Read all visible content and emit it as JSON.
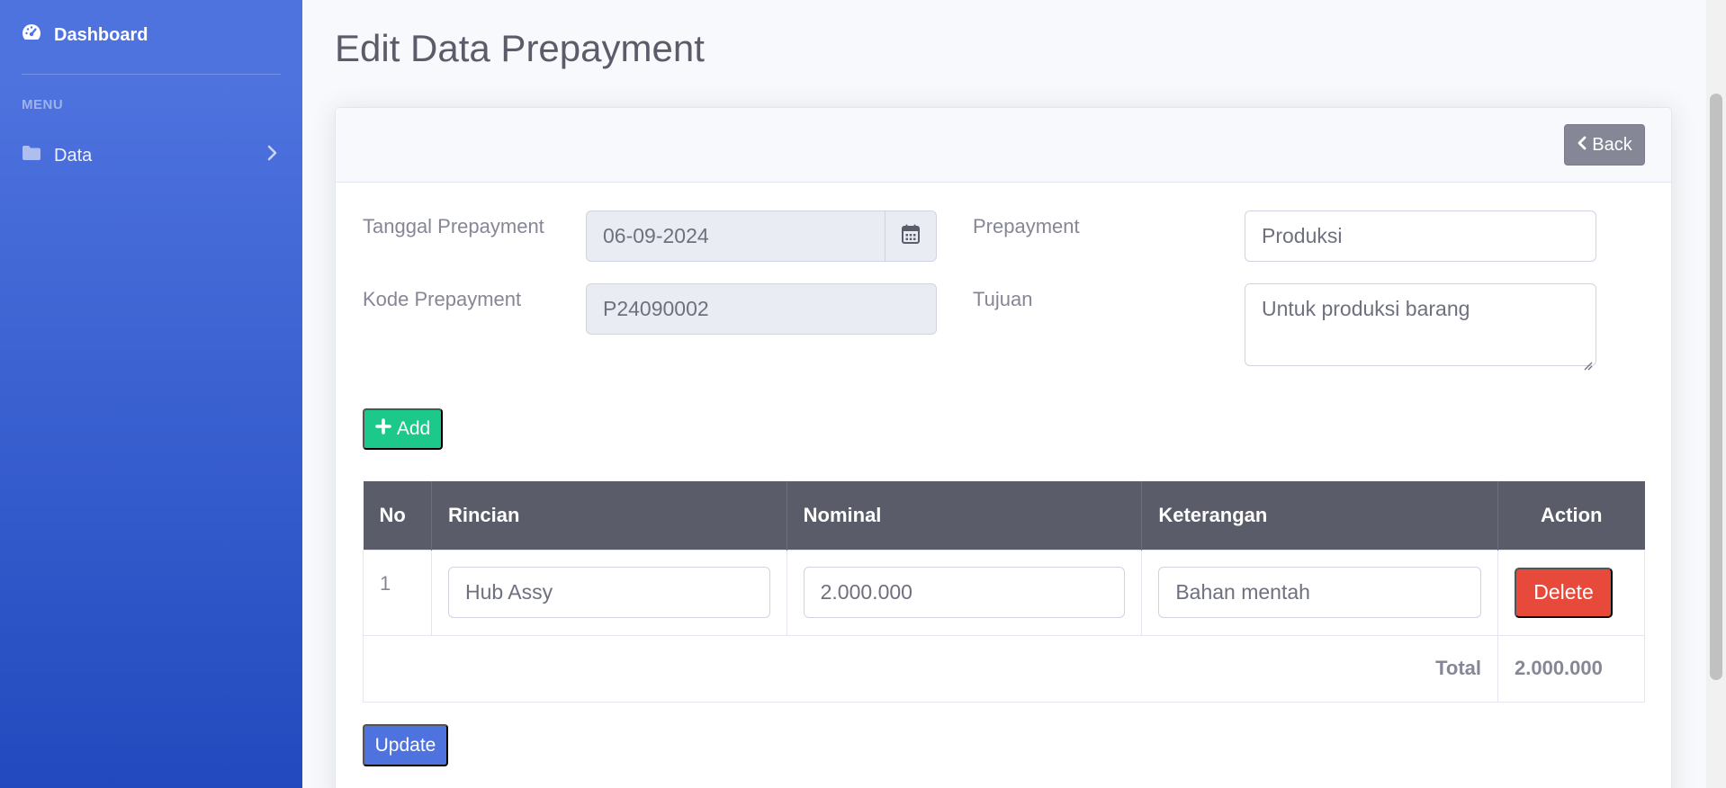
{
  "sidebar": {
    "brand": "Dashboard",
    "heading": "MENU",
    "items": [
      {
        "label": "Data"
      }
    ]
  },
  "page": {
    "title": "Edit Data Prepayment"
  },
  "header": {
    "back_label": "Back"
  },
  "form": {
    "tanggal_label": "Tanggal Prepayment",
    "tanggal_value": "06-09-2024",
    "kode_label": "Kode Prepayment",
    "kode_value": "P24090002",
    "prepayment_label": "Prepayment",
    "prepayment_value": "Produksi",
    "tujuan_label": "Tujuan",
    "tujuan_value": "Untuk produksi barang"
  },
  "actions": {
    "add_label": "Add",
    "update_label": "Update",
    "delete_label": "Delete"
  },
  "table": {
    "headers": [
      "No",
      "Rincian",
      "Nominal",
      "Keterangan",
      "Action"
    ],
    "rows": [
      {
        "no": "1",
        "rincian": "Hub Assy",
        "nominal": "2.000.000",
        "keterangan": "Bahan mentah"
      }
    ],
    "total_label": "Total",
    "total_value": "2.000.000"
  },
  "colors": {
    "primary": "#4e73df",
    "success": "#1cc88a",
    "danger": "#e74a3b",
    "secondary": "#858796",
    "dark": "#5a5c69"
  }
}
